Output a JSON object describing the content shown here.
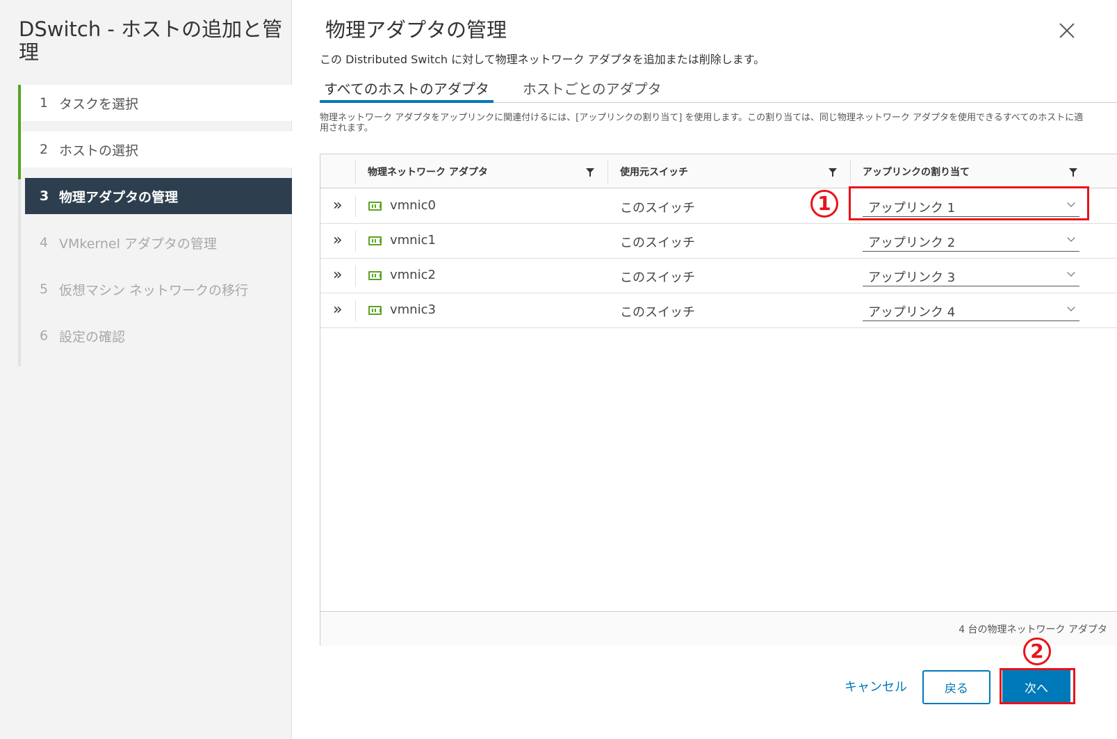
{
  "wizard": {
    "title": "DSwitch - ホストの追加と管理",
    "steps": [
      {
        "num": "1",
        "label": "タスクを選択",
        "state": "done"
      },
      {
        "num": "2",
        "label": "ホストの選択",
        "state": "done"
      },
      {
        "num": "3",
        "label": "物理アダプタの管理",
        "state": "current"
      },
      {
        "num": "4",
        "label": "VMkernel アダプタの管理",
        "state": "future"
      },
      {
        "num": "5",
        "label": "仮想マシン ネットワークの移行",
        "state": "future"
      },
      {
        "num": "6",
        "label": "設定の確認",
        "state": "future"
      }
    ]
  },
  "page": {
    "title": "物理アダプタの管理",
    "description": "この Distributed Switch に対して物理ネットワーク アダプタを追加または削除します。",
    "tabs": [
      {
        "label": "すべてのホストのアダプタ",
        "active": true
      },
      {
        "label": "ホストごとのアダプタ",
        "active": false
      }
    ],
    "info": "物理ネットワーク アダプタをアップリンクに関連付けるには、[アップリンクの割り当て] を使用します。この割り当ては、同じ物理ネットワーク アダプタを使用できるすべてのホストに適用されます。"
  },
  "grid": {
    "columns": [
      "物理ネットワーク アダプタ",
      "使用元スイッチ",
      "アップリンクの割り当て"
    ],
    "rows": [
      {
        "adapter": "vmnic0",
        "switch": "このスイッチ",
        "uplink": "アップリンク 1"
      },
      {
        "adapter": "vmnic1",
        "switch": "このスイッチ",
        "uplink": "アップリンク 2"
      },
      {
        "adapter": "vmnic2",
        "switch": "このスイッチ",
        "uplink": "アップリンク 3"
      },
      {
        "adapter": "vmnic3",
        "switch": "このスイッチ",
        "uplink": "アップリンク 4"
      }
    ],
    "footer": "4 台の物理ネットワーク アダプタ"
  },
  "annotations": {
    "marker1": "1",
    "marker2": "2",
    "color": "#e8121a"
  },
  "buttons": {
    "cancel": "キャンセル",
    "back": "戻る",
    "next": "次へ"
  },
  "colors": {
    "accent": "#0079b8",
    "active_step_bg": "#2d3e4f",
    "progress": "#5aa220"
  }
}
